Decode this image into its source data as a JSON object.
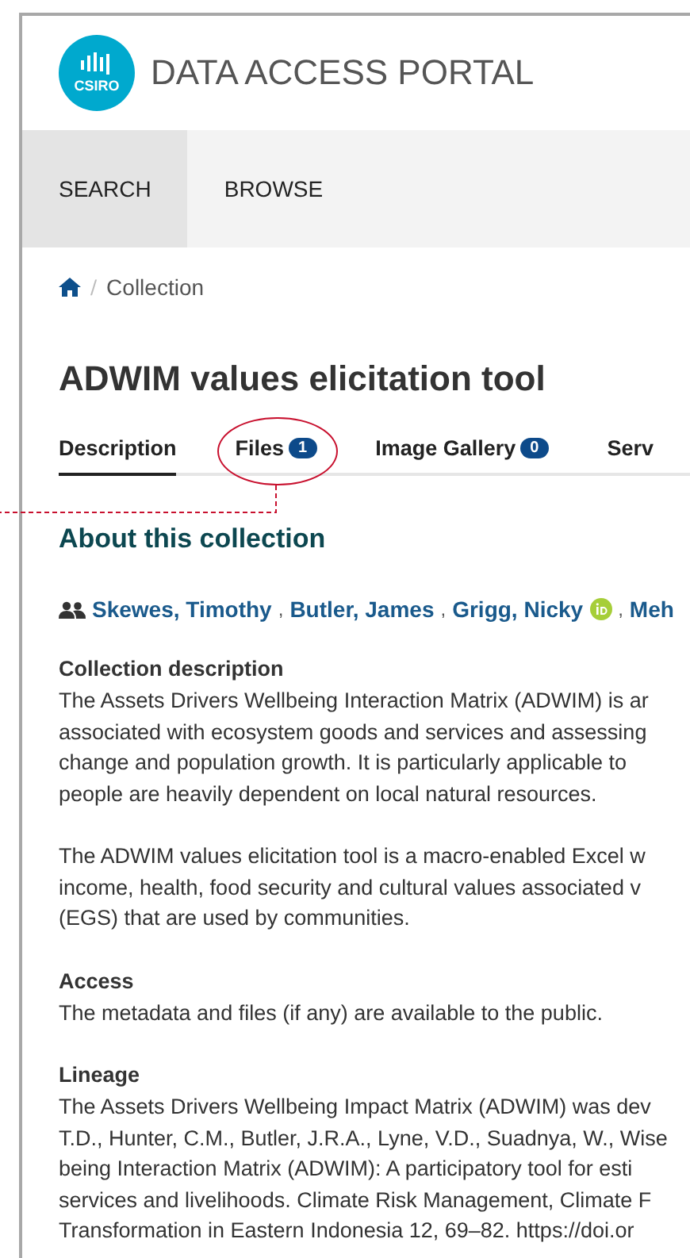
{
  "header": {
    "logo_text": "CSIRO",
    "title": "DATA ACCESS PORTAL"
  },
  "nav": [
    {
      "label": "SEARCH",
      "selected": true
    },
    {
      "label": "BROWSE",
      "selected": false
    }
  ],
  "breadcrumb": [
    "Collection"
  ],
  "breadcrumb_separator": "/",
  "author_separator": ",",
  "title": "ADWIM values elicitation tool",
  "tabs": [
    {
      "label": "Description",
      "selected": true
    },
    {
      "label": "Files",
      "count": "1",
      "selected": false,
      "circled": true
    },
    {
      "label": "Image Gallery",
      "count": "0",
      "selected": false
    },
    {
      "label": "Serv",
      "selected": false
    }
  ],
  "section_heading": "About this collection",
  "authors": [
    {
      "name": "Skewes, Timothy",
      "orcid": false
    },
    {
      "name": "Butler, James",
      "orcid": false
    },
    {
      "name": "Grigg, Nicky",
      "orcid": true
    },
    {
      "name": "Meh",
      "orcid": false
    }
  ],
  "sections": [
    {
      "heading": "Collection description",
      "paragraphs": [
        [
          "The Assets Drivers Wellbeing Interaction Matrix (ADWIM) is ar",
          "associated with ecosystem goods and services and assessing",
          "change and population growth. It is particularly applicable to",
          "people are heavily dependent on local natural resources."
        ],
        [
          "The ADWIM values elicitation tool is a macro-enabled Excel w",
          "income, health, food security and cultural values associated v",
          "(EGS) that are used by communities."
        ]
      ]
    },
    {
      "heading": "Access",
      "paragraphs": [
        [
          "The metadata and files (if any) are available to the public."
        ]
      ]
    },
    {
      "heading": "Lineage",
      "paragraphs": [
        [
          "The Assets Drivers Wellbeing Impact Matrix (ADWIM) was dev",
          "T.D., Hunter, C.M., Butler, J.R.A., Lyne, V.D., Suadnya, W., Wise",
          "being Interaction Matrix (ADWIM): A participatory tool for esti",
          "services and livelihoods. Climate Risk Management, Climate F",
          "Transformation in Eastern Indonesia 12, 69–82. https://doi.or"
        ]
      ]
    }
  ]
}
